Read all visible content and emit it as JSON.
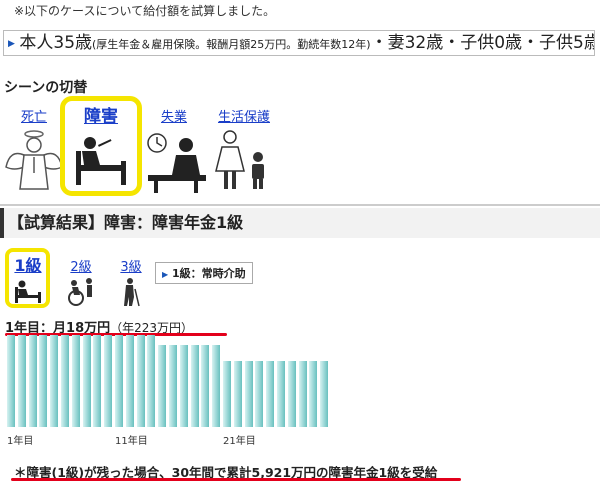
{
  "note": "※以下のケースについて給付額を試算しました。",
  "profile": {
    "part1": "本人",
    "age1": "35歳",
    "detail": "(厚生年金＆雇用保険。報酬月額25万円。勤続年数12年)",
    "part2": "・妻32歳・子供0歳・子供5歳"
  },
  "scene": {
    "title": "シーンの切替",
    "items": [
      {
        "label": "死亡",
        "icon": "angel-icon",
        "active": false
      },
      {
        "label": "障害",
        "icon": "person-in-bed-icon",
        "active": true
      },
      {
        "label": "失業",
        "icon": "unemployed-desk-icon",
        "active": false
      },
      {
        "label": "生活保護",
        "icon": "family-icon",
        "active": false
      }
    ]
  },
  "result": {
    "title": "【試算結果】障害：障害年金1級"
  },
  "grades": {
    "items": [
      {
        "label": "1級",
        "active": true,
        "icon": "bed-icon"
      },
      {
        "label": "2級",
        "active": false,
        "icon": "wheelchair-icon"
      },
      {
        "label": "3級",
        "active": false,
        "icon": "cane-icon"
      }
    ],
    "note": "1級：常時介助"
  },
  "year1": {
    "main": "1年目：月18万円",
    "sub": "（年223万円）"
  },
  "chart_data": {
    "type": "bar",
    "categories": [
      "1年目",
      "",
      "",
      "",
      "",
      "",
      "",
      "",
      "",
      "",
      "11年目",
      "",
      "",
      "",
      "",
      "",
      "",
      "",
      "",
      "",
      "21年目",
      "",
      "",
      "",
      "",
      "",
      "",
      "",
      "",
      ""
    ],
    "values": [
      18,
      18,
      18,
      18,
      18,
      18,
      18,
      18,
      18,
      18,
      18,
      18,
      18,
      18,
      16,
      16,
      16,
      16,
      16,
      16,
      13,
      13,
      13,
      13,
      13,
      13,
      13,
      13,
      13,
      13
    ],
    "axis_labels": [
      "1年目",
      "11年目",
      "21年目"
    ]
  },
  "final": "＊障害(1級)が残った場合、30年間で累計5,921万円の障害年金1級を受給"
}
